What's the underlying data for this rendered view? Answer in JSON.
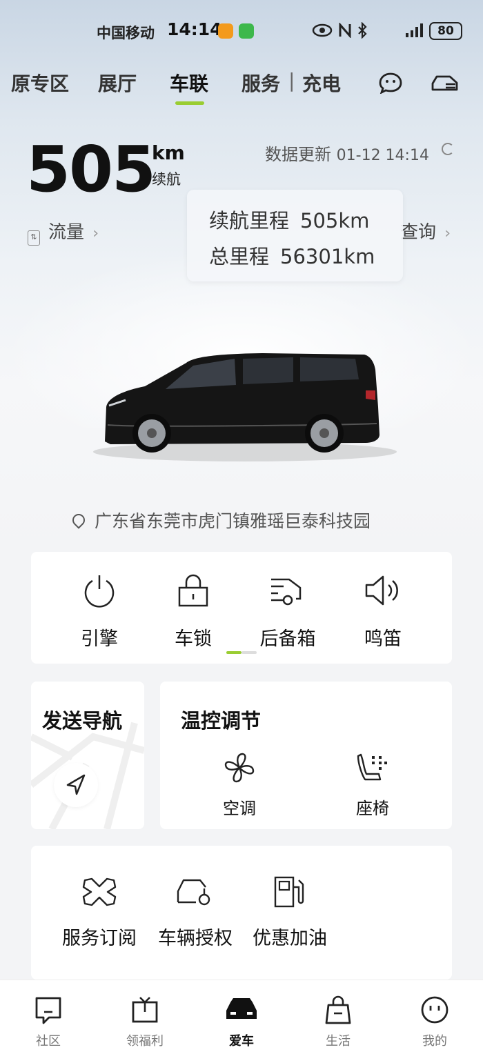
{
  "status_bar": {
    "carrier": "中国移动",
    "time": "14:14",
    "battery": "80"
  },
  "tabs": [
    {
      "label": "原专区"
    },
    {
      "label": "展厅"
    },
    {
      "label": "车联"
    },
    {
      "label": "服务"
    },
    {
      "label": "充电"
    }
  ],
  "tab_separator": "|",
  "range": {
    "value": "505",
    "unit": "km",
    "label": "续航"
  },
  "update": {
    "label": "数据更新",
    "datetime": "01-12 14:14"
  },
  "flow_link": "流量",
  "query_link": "查询",
  "tooltip": {
    "rows": [
      {
        "label": "续航里程",
        "value": "505km"
      },
      {
        "label": "总里程",
        "value": "56301km"
      }
    ]
  },
  "location": "广东省东莞市虎门镇雅瑶巨泰科技园",
  "controls": [
    {
      "label": "引擎",
      "icon": "power-icon"
    },
    {
      "label": "车锁",
      "icon": "lock-icon"
    },
    {
      "label": "后备箱",
      "icon": "trunk-icon"
    },
    {
      "label": "鸣笛",
      "icon": "horn-icon"
    }
  ],
  "send_nav": {
    "title": "发送导航"
  },
  "climate": {
    "title": "温控调节",
    "items": [
      {
        "label": "空调",
        "icon": "fan-icon"
      },
      {
        "label": "座椅",
        "icon": "seat-heat-icon"
      }
    ]
  },
  "services": [
    {
      "label": "服务订阅",
      "icon": "service-subscribe-icon"
    },
    {
      "label": "车辆授权",
      "icon": "vehicle-auth-icon"
    },
    {
      "label": "优惠加油",
      "icon": "fuel-icon"
    }
  ],
  "bottom_nav": [
    {
      "label": "社区"
    },
    {
      "label": "领福利"
    },
    {
      "label": "爱车"
    },
    {
      "label": "生活"
    },
    {
      "label": "我的"
    }
  ],
  "colors": {
    "accent": "#9acd32",
    "text_primary": "#111111",
    "background": "#f3f4f6"
  }
}
